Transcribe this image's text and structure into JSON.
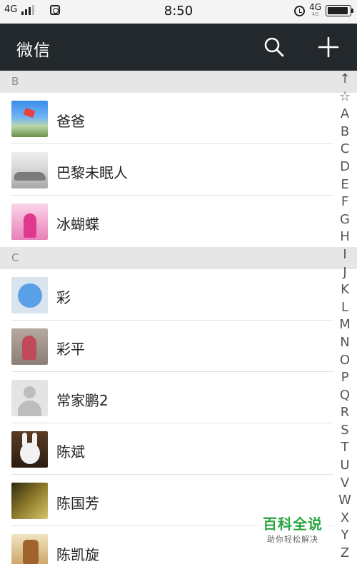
{
  "status_bar": {
    "network_left": "4G",
    "time": "8:50",
    "network_right": "4G",
    "network_right_sub": "4G"
  },
  "header": {
    "title": "微信",
    "icons": [
      "search-icon",
      "plus-icon"
    ]
  },
  "contacts": {
    "sections": [
      {
        "letter": "B",
        "items": [
          {
            "name": "爸爸"
          },
          {
            "name": "巴黎未眠人"
          },
          {
            "name": "冰蝴蝶"
          }
        ]
      },
      {
        "letter": "C",
        "items": [
          {
            "name": "彩"
          },
          {
            "name": "彩平"
          },
          {
            "name": "常家鹏2"
          },
          {
            "name": "陈斌"
          },
          {
            "name": "陈国芳"
          },
          {
            "name": "陈凯旋"
          }
        ]
      }
    ]
  },
  "index_bar": [
    "↑",
    "☆",
    "A",
    "B",
    "C",
    "D",
    "E",
    "F",
    "G",
    "H",
    "I",
    "J",
    "K",
    "L",
    "M",
    "N",
    "O",
    "P",
    "Q",
    "R",
    "S",
    "T",
    "U",
    "V",
    "W",
    "X",
    "Y",
    "Z"
  ],
  "watermark": {
    "main": "百科全说",
    "sub": "助你轻松解决"
  },
  "colors": {
    "header_bg": "#23282c",
    "section_bg": "#e6e6e6",
    "watermark_green": "#2aa640"
  }
}
